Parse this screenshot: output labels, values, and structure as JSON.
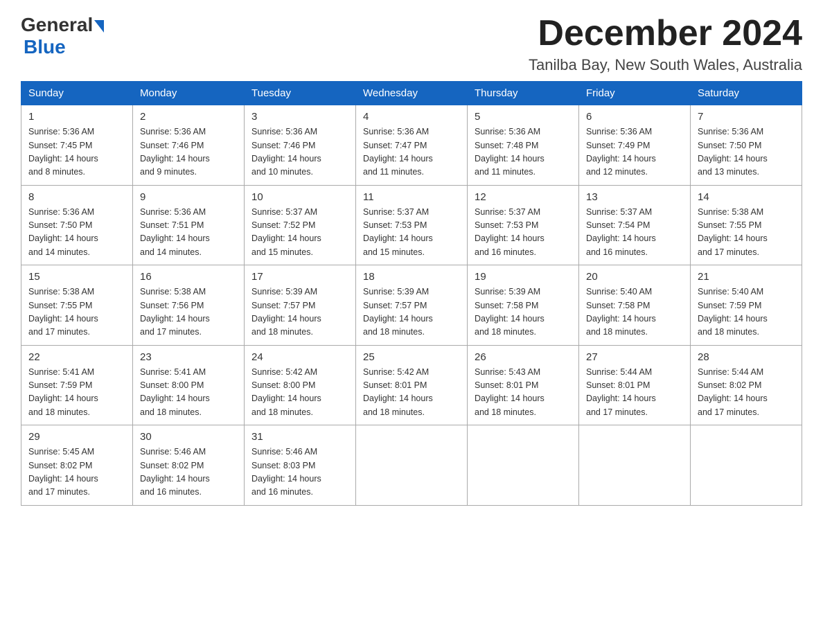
{
  "header": {
    "logo_general": "General",
    "logo_blue": "Blue",
    "month_title": "December 2024",
    "location": "Tanilba Bay, New South Wales, Australia"
  },
  "columns": [
    "Sunday",
    "Monday",
    "Tuesday",
    "Wednesday",
    "Thursday",
    "Friday",
    "Saturday"
  ],
  "weeks": [
    [
      {
        "day": "1",
        "info": "Sunrise: 5:36 AM\nSunset: 7:45 PM\nDaylight: 14 hours\nand 8 minutes."
      },
      {
        "day": "2",
        "info": "Sunrise: 5:36 AM\nSunset: 7:46 PM\nDaylight: 14 hours\nand 9 minutes."
      },
      {
        "day": "3",
        "info": "Sunrise: 5:36 AM\nSunset: 7:46 PM\nDaylight: 14 hours\nand 10 minutes."
      },
      {
        "day": "4",
        "info": "Sunrise: 5:36 AM\nSunset: 7:47 PM\nDaylight: 14 hours\nand 11 minutes."
      },
      {
        "day": "5",
        "info": "Sunrise: 5:36 AM\nSunset: 7:48 PM\nDaylight: 14 hours\nand 11 minutes."
      },
      {
        "day": "6",
        "info": "Sunrise: 5:36 AM\nSunset: 7:49 PM\nDaylight: 14 hours\nand 12 minutes."
      },
      {
        "day": "7",
        "info": "Sunrise: 5:36 AM\nSunset: 7:50 PM\nDaylight: 14 hours\nand 13 minutes."
      }
    ],
    [
      {
        "day": "8",
        "info": "Sunrise: 5:36 AM\nSunset: 7:50 PM\nDaylight: 14 hours\nand 14 minutes."
      },
      {
        "day": "9",
        "info": "Sunrise: 5:36 AM\nSunset: 7:51 PM\nDaylight: 14 hours\nand 14 minutes."
      },
      {
        "day": "10",
        "info": "Sunrise: 5:37 AM\nSunset: 7:52 PM\nDaylight: 14 hours\nand 15 minutes."
      },
      {
        "day": "11",
        "info": "Sunrise: 5:37 AM\nSunset: 7:53 PM\nDaylight: 14 hours\nand 15 minutes."
      },
      {
        "day": "12",
        "info": "Sunrise: 5:37 AM\nSunset: 7:53 PM\nDaylight: 14 hours\nand 16 minutes."
      },
      {
        "day": "13",
        "info": "Sunrise: 5:37 AM\nSunset: 7:54 PM\nDaylight: 14 hours\nand 16 minutes."
      },
      {
        "day": "14",
        "info": "Sunrise: 5:38 AM\nSunset: 7:55 PM\nDaylight: 14 hours\nand 17 minutes."
      }
    ],
    [
      {
        "day": "15",
        "info": "Sunrise: 5:38 AM\nSunset: 7:55 PM\nDaylight: 14 hours\nand 17 minutes."
      },
      {
        "day": "16",
        "info": "Sunrise: 5:38 AM\nSunset: 7:56 PM\nDaylight: 14 hours\nand 17 minutes."
      },
      {
        "day": "17",
        "info": "Sunrise: 5:39 AM\nSunset: 7:57 PM\nDaylight: 14 hours\nand 18 minutes."
      },
      {
        "day": "18",
        "info": "Sunrise: 5:39 AM\nSunset: 7:57 PM\nDaylight: 14 hours\nand 18 minutes."
      },
      {
        "day": "19",
        "info": "Sunrise: 5:39 AM\nSunset: 7:58 PM\nDaylight: 14 hours\nand 18 minutes."
      },
      {
        "day": "20",
        "info": "Sunrise: 5:40 AM\nSunset: 7:58 PM\nDaylight: 14 hours\nand 18 minutes."
      },
      {
        "day": "21",
        "info": "Sunrise: 5:40 AM\nSunset: 7:59 PM\nDaylight: 14 hours\nand 18 minutes."
      }
    ],
    [
      {
        "day": "22",
        "info": "Sunrise: 5:41 AM\nSunset: 7:59 PM\nDaylight: 14 hours\nand 18 minutes."
      },
      {
        "day": "23",
        "info": "Sunrise: 5:41 AM\nSunset: 8:00 PM\nDaylight: 14 hours\nand 18 minutes."
      },
      {
        "day": "24",
        "info": "Sunrise: 5:42 AM\nSunset: 8:00 PM\nDaylight: 14 hours\nand 18 minutes."
      },
      {
        "day": "25",
        "info": "Sunrise: 5:42 AM\nSunset: 8:01 PM\nDaylight: 14 hours\nand 18 minutes."
      },
      {
        "day": "26",
        "info": "Sunrise: 5:43 AM\nSunset: 8:01 PM\nDaylight: 14 hours\nand 18 minutes."
      },
      {
        "day": "27",
        "info": "Sunrise: 5:44 AM\nSunset: 8:01 PM\nDaylight: 14 hours\nand 17 minutes."
      },
      {
        "day": "28",
        "info": "Sunrise: 5:44 AM\nSunset: 8:02 PM\nDaylight: 14 hours\nand 17 minutes."
      }
    ],
    [
      {
        "day": "29",
        "info": "Sunrise: 5:45 AM\nSunset: 8:02 PM\nDaylight: 14 hours\nand 17 minutes."
      },
      {
        "day": "30",
        "info": "Sunrise: 5:46 AM\nSunset: 8:02 PM\nDaylight: 14 hours\nand 16 minutes."
      },
      {
        "day": "31",
        "info": "Sunrise: 5:46 AM\nSunset: 8:03 PM\nDaylight: 14 hours\nand 16 minutes."
      },
      {
        "day": "",
        "info": ""
      },
      {
        "day": "",
        "info": ""
      },
      {
        "day": "",
        "info": ""
      },
      {
        "day": "",
        "info": ""
      }
    ]
  ]
}
